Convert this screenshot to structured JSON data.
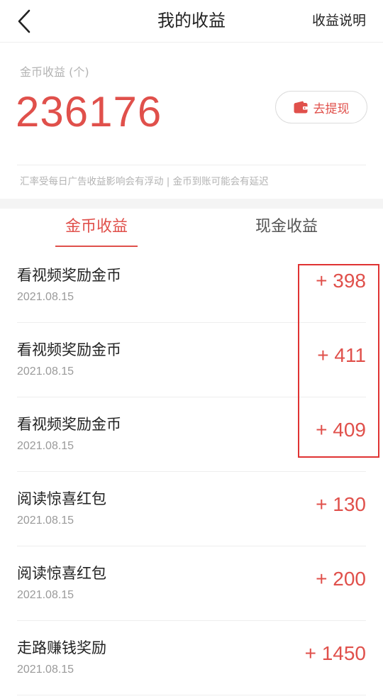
{
  "header": {
    "title": "我的收益",
    "help_label": "收益说明"
  },
  "balance": {
    "label": "金币收益 (个)",
    "value": "236176",
    "withdraw_label": "去提现"
  },
  "notice": "汇率受每日广告收益影响会有浮动 | 金币到账可能会有延迟",
  "tabs": [
    {
      "label": "金币收益",
      "active": true
    },
    {
      "label": "现金收益",
      "active": false
    }
  ],
  "records": [
    {
      "name": "看视频奖励金币",
      "date": "2021.08.15",
      "amount": "+ 398"
    },
    {
      "name": "看视频奖励金币",
      "date": "2021.08.15",
      "amount": "+ 411"
    },
    {
      "name": "看视频奖励金币",
      "date": "2021.08.15",
      "amount": "+ 409"
    },
    {
      "name": "阅读惊喜红包",
      "date": "2021.08.15",
      "amount": "+ 130"
    },
    {
      "name": "阅读惊喜红包",
      "date": "2021.08.15",
      "amount": "+ 200"
    },
    {
      "name": "走路赚钱奖励",
      "date": "2021.08.15",
      "amount": "+ 1450"
    }
  ],
  "colors": {
    "accent": "#e0504b",
    "highlight": "#e03333"
  },
  "icons": {
    "back": "chevron-left-icon",
    "withdraw": "wallet-icon"
  }
}
